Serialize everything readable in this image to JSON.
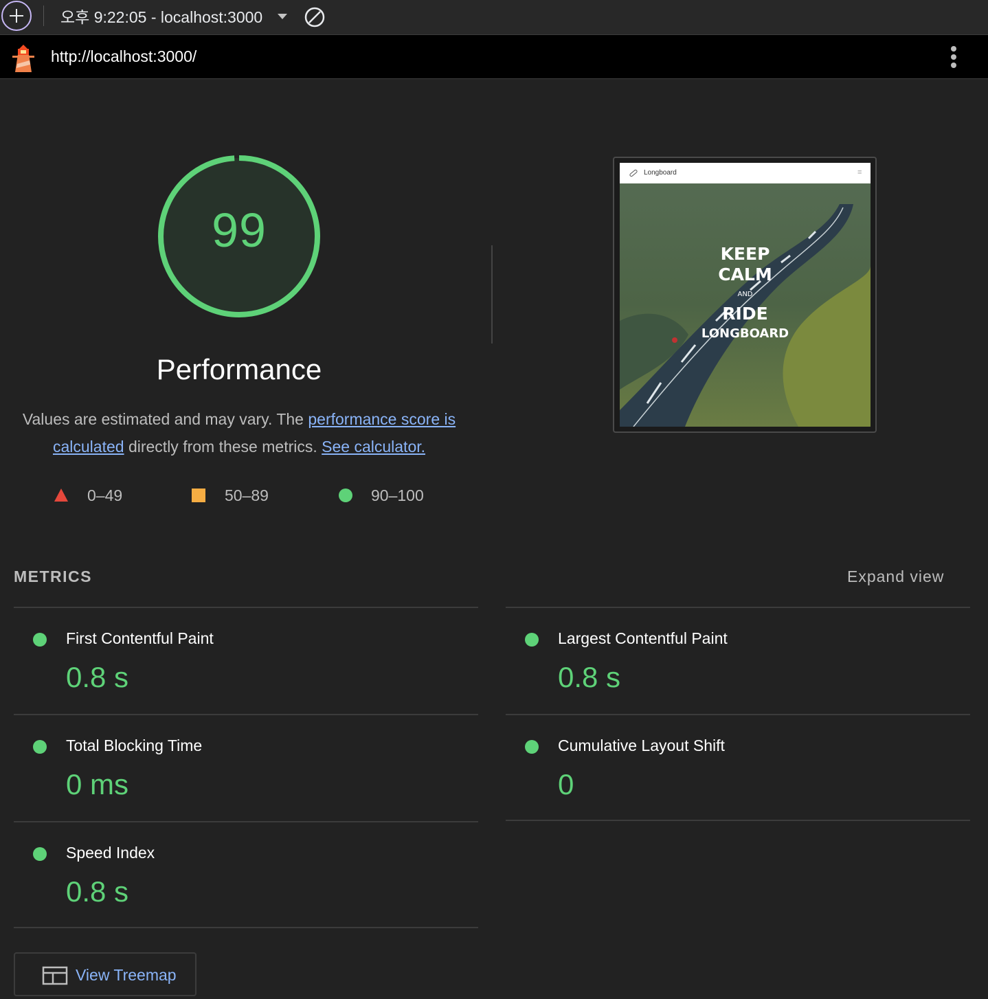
{
  "toolbar": {
    "report_select": "오후 9:22:05 - localhost:3000",
    "new_report_icon": "plus-circle-icon",
    "clear_icon": "clear-circle-slash-icon"
  },
  "urlbar": {
    "url": "http://localhost:3000/",
    "menu_icon": "kebab-menu-icon"
  },
  "gauge": {
    "score": "99",
    "score_fraction": 0.99,
    "title": "Performance",
    "color": "#5ed278"
  },
  "description": {
    "part1": "Values are estimated and may vary. The ",
    "link1": "performance score is calculated",
    "part2": " directly from these metrics. ",
    "link2": "See calculator."
  },
  "legend": [
    {
      "range": "0–49",
      "shape": "triangle",
      "color": "#e5483c"
    },
    {
      "range": "50–89",
      "shape": "square",
      "color": "#f6ad43"
    },
    {
      "range": "90–100",
      "shape": "circle",
      "color": "#5ed278"
    }
  ],
  "screenshot": {
    "brand": "Longboard",
    "line1": "KEEP",
    "line2": "CALM",
    "line3": "AND",
    "line4": "RIDE",
    "line5": "LONGBOARD"
  },
  "metrics": {
    "title": "METRICS",
    "expand_label": "Expand view",
    "items": [
      {
        "label": "First Contentful Paint",
        "value": "0.8 s"
      },
      {
        "label": "Largest Contentful Paint",
        "value": "0.8 s"
      },
      {
        "label": "Total Blocking Time",
        "value": "0 ms"
      },
      {
        "label": "Cumulative Layout Shift",
        "value": "0"
      },
      {
        "label": "Speed Index",
        "value": "0.8 s"
      }
    ]
  },
  "treemap": {
    "label": "View Treemap",
    "icon": "treemap-icon"
  }
}
